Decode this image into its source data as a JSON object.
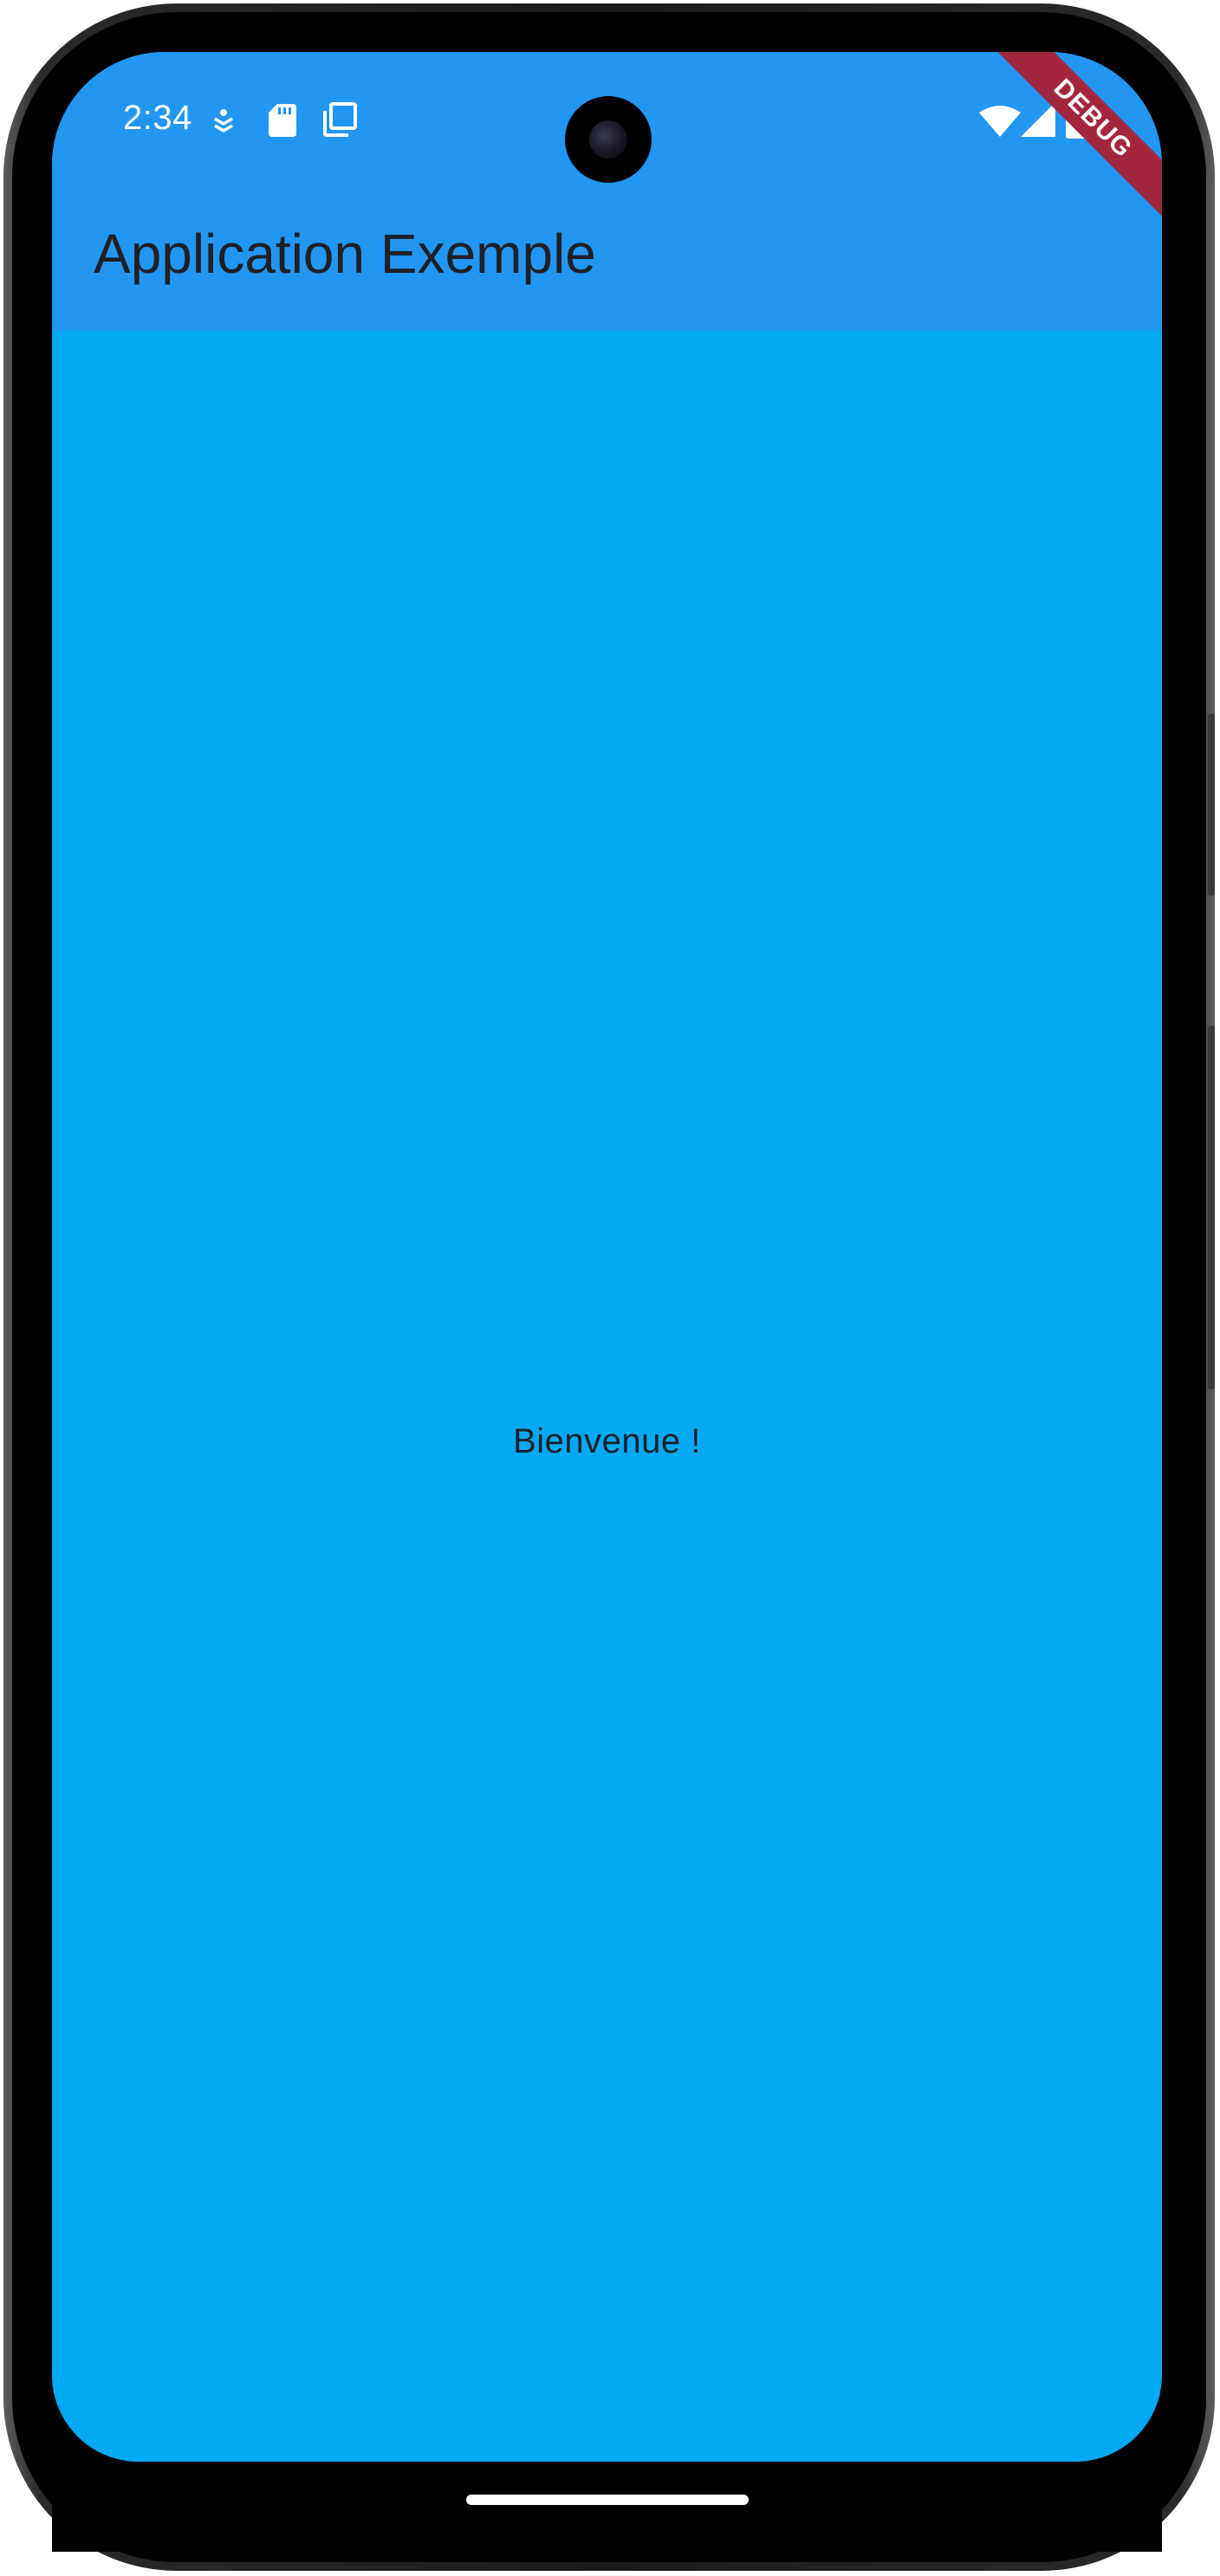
{
  "status_bar": {
    "time": "2:34",
    "left_icons": [
      "accessibility-icon",
      "sd-card-icon",
      "copy-icon"
    ],
    "right_icons": [
      "wifi-icon",
      "signal-icon",
      "battery-icon"
    ],
    "icon_color": "#ffffff"
  },
  "app_bar": {
    "title": "Application Exemple",
    "background": "#2196f3"
  },
  "debug_banner": {
    "label": "DEBUG",
    "color": "#a3263f"
  },
  "body": {
    "message": "Bienvenue !",
    "background": "#03a9f4"
  }
}
